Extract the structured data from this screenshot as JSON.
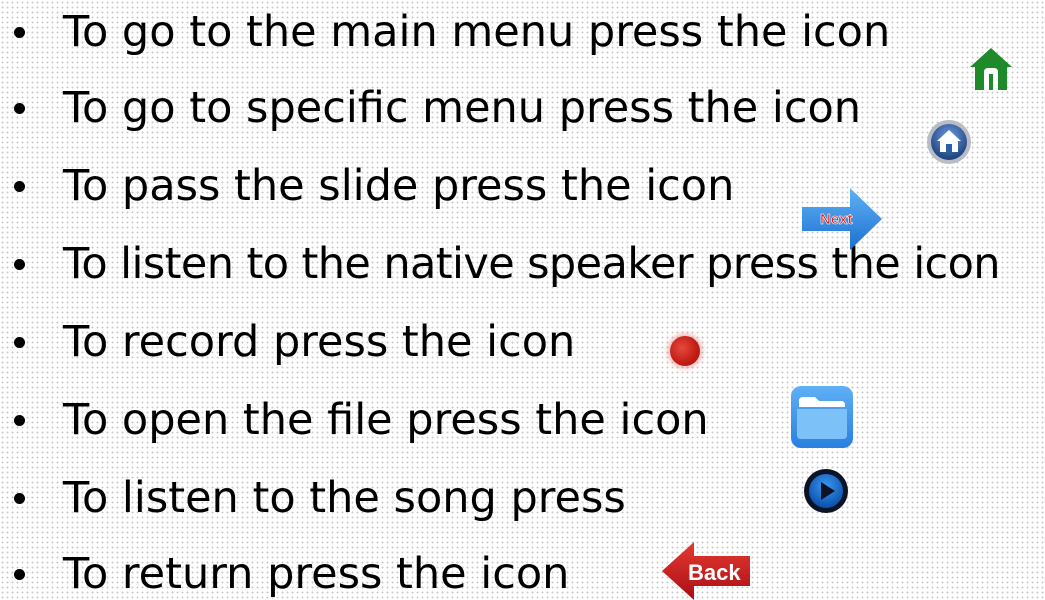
{
  "slide": {
    "bullets": [
      "To go to the main menu press the icon",
      "To go to specific menu press the icon",
      "To pass the slide press the icon",
      "To listen to the native speaker press the icon",
      "To record press the icon",
      "To open the file press the icon",
      "To listen to the song press",
      "To return press the icon"
    ],
    "next_label": "Next",
    "back_label": "Back"
  },
  "icons": {
    "main_menu": "home-icon",
    "specific_menu": "home-button-icon",
    "next": "next-arrow-icon",
    "record": "record-icon",
    "file": "folder-icon",
    "song": "play-icon",
    "back": "back-arrow-icon"
  },
  "colors": {
    "home_green": "#1f8a2a",
    "home_blue": "#2b5fa8",
    "next_blue": "#2f8fe8",
    "record_red": "#d32a1f",
    "folder_blue": "#3d96ec",
    "play_blue": "#0a6fd8",
    "back_red": "#c2151b"
  }
}
